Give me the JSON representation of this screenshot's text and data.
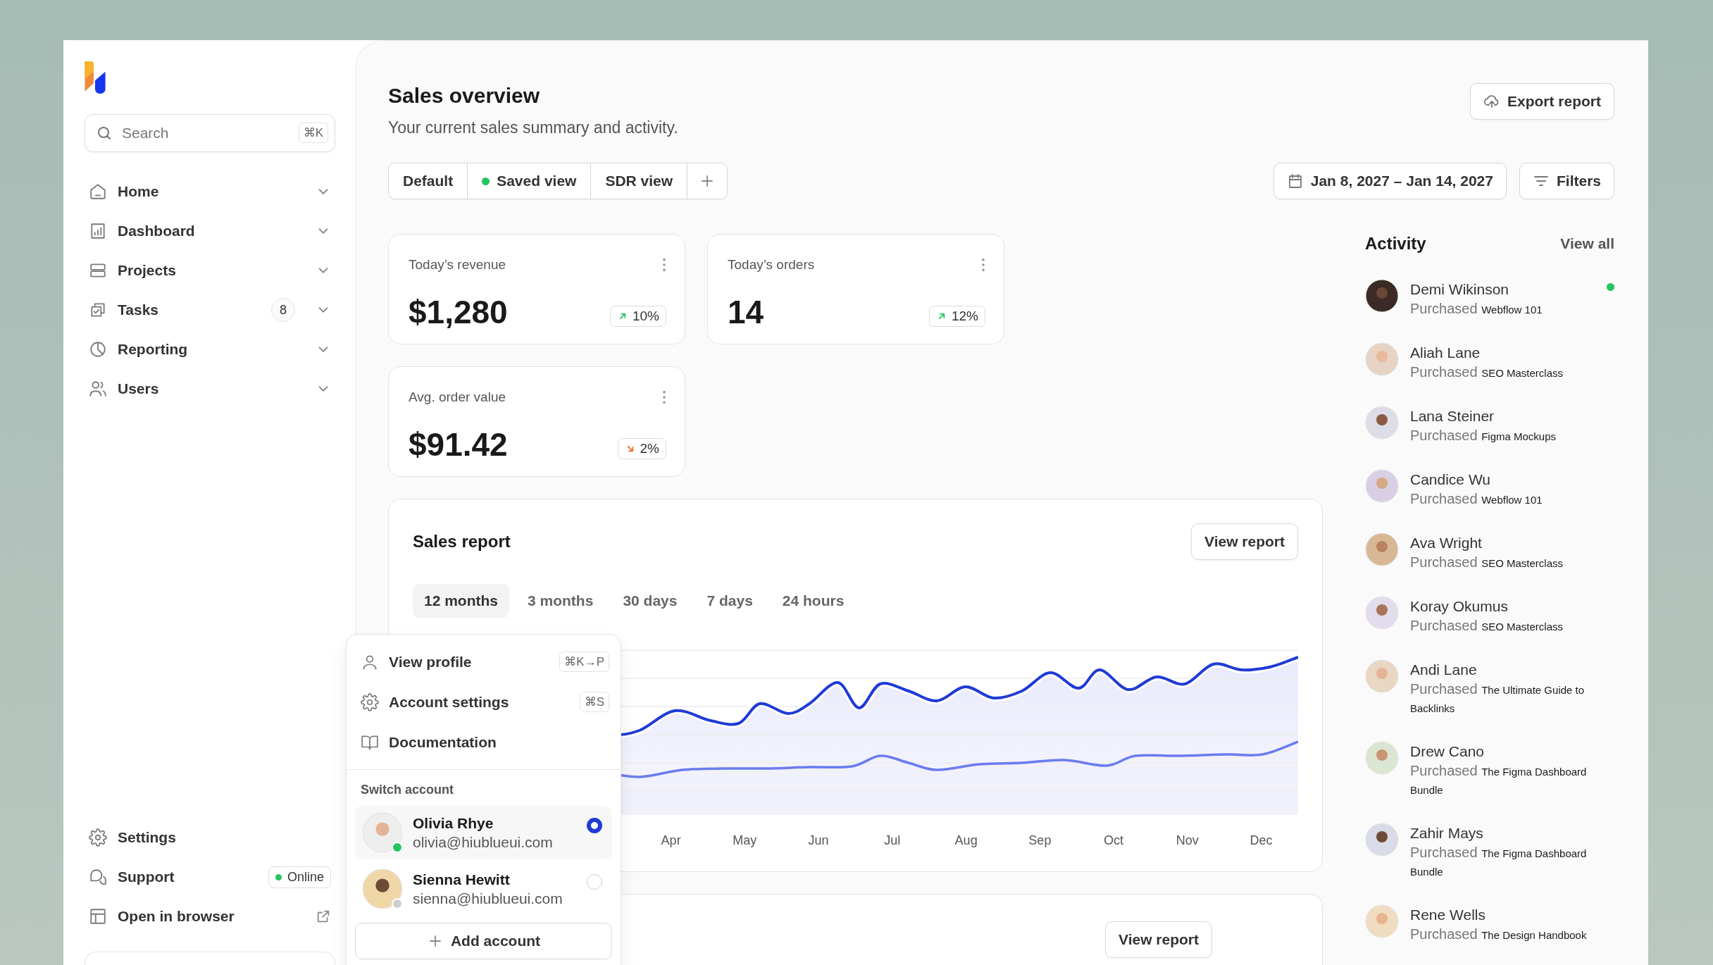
{
  "search": {
    "placeholder": "Search",
    "shortcut": "⌘K"
  },
  "nav": [
    {
      "label": "Home"
    },
    {
      "label": "Dashboard"
    },
    {
      "label": "Projects"
    },
    {
      "label": "Tasks",
      "badge": "8"
    },
    {
      "label": "Reporting"
    },
    {
      "label": "Users"
    }
  ],
  "footer_nav": [
    {
      "label": "Settings",
      "kind": "plain"
    },
    {
      "label": "Support",
      "kind": "status",
      "status": "Online",
      "online": true
    },
    {
      "label": "Open in browser",
      "kind": "external"
    }
  ],
  "header": {
    "title": "Sales overview",
    "subtitle": "Your current sales summary and activity.",
    "export_button": "Export report"
  },
  "views": [
    {
      "label": "Default",
      "dot": false
    },
    {
      "label": "Saved view",
      "dot": true
    },
    {
      "label": "SDR view",
      "dot": false
    }
  ],
  "date_range": "Jan 8, 2027 – Jan 14, 2027",
  "filters_button": "Filters",
  "metrics": [
    {
      "label": "Today’s revenue",
      "value": "$1,280",
      "change": "10%",
      "rising": true
    },
    {
      "label": "Today’s orders",
      "value": "14",
      "change": "12%",
      "rising": true
    },
    {
      "label": "Avg. order value",
      "value": "$91.42",
      "change": "2%",
      "rising": false
    }
  ],
  "sales_report": {
    "title": "Sales report",
    "button": "View report",
    "periods": [
      {
        "label": "12 months",
        "selected": true
      },
      {
        "label": "3 months",
        "selected": false
      },
      {
        "label": "30 days",
        "selected": false
      },
      {
        "label": "7 days",
        "selected": false
      },
      {
        "label": "24 hours",
        "selected": false
      }
    ],
    "chart_months": [
      "Apr",
      "May",
      "Jun",
      "Jul",
      "Aug",
      "Sep",
      "Oct",
      "Nov",
      "Dec"
    ]
  },
  "second_report": {
    "button": "View report"
  },
  "activity": {
    "title": "Activity",
    "view_all": "View all",
    "items": [
      {
        "name": "Demi Wikinson",
        "action": "Purchased",
        "product": "Webflow 101",
        "unread": true
      },
      {
        "name": "Aliah Lane",
        "action": "Purchased",
        "product": "SEO Masterclass",
        "unread": false
      },
      {
        "name": "Lana Steiner",
        "action": "Purchased",
        "product": "Figma Mockups",
        "unread": false
      },
      {
        "name": "Candice Wu",
        "action": "Purchased",
        "product": "Webflow 101",
        "unread": false
      },
      {
        "name": "Ava Wright",
        "action": "Purchased",
        "product": "SEO Masterclass",
        "unread": false
      },
      {
        "name": "Koray Okumus",
        "action": "Purchased",
        "product": "SEO Masterclass",
        "unread": false
      },
      {
        "name": "Andi Lane",
        "action": "Purchased",
        "product": "The Ultimate Guide to Backlinks",
        "unread": false
      },
      {
        "name": "Drew Cano",
        "action": "Purchased",
        "product": "The Figma Dashboard Bundle",
        "unread": false
      },
      {
        "name": "Zahir Mays",
        "action": "Purchased",
        "product": "The Figma Dashboard Bundle",
        "unread": false
      },
      {
        "name": "Rene Wells",
        "action": "Purchased",
        "product": "The Design Handbook",
        "unread": false
      }
    ]
  },
  "account_menu": {
    "items": [
      {
        "label": "View profile",
        "shortcut": "⌘K→P"
      },
      {
        "label": "Account settings",
        "shortcut": "⌘S"
      },
      {
        "label": "Documentation"
      }
    ],
    "section": "Switch account",
    "accounts": [
      {
        "name": "Olivia Rhye",
        "email": "olivia@hiublueui.com",
        "selected": true,
        "online": true
      },
      {
        "name": "Sienna Hewitt",
        "email": "sienna@hiublueui.com",
        "selected": false,
        "online": false
      }
    ],
    "add_button": "Add account"
  }
}
